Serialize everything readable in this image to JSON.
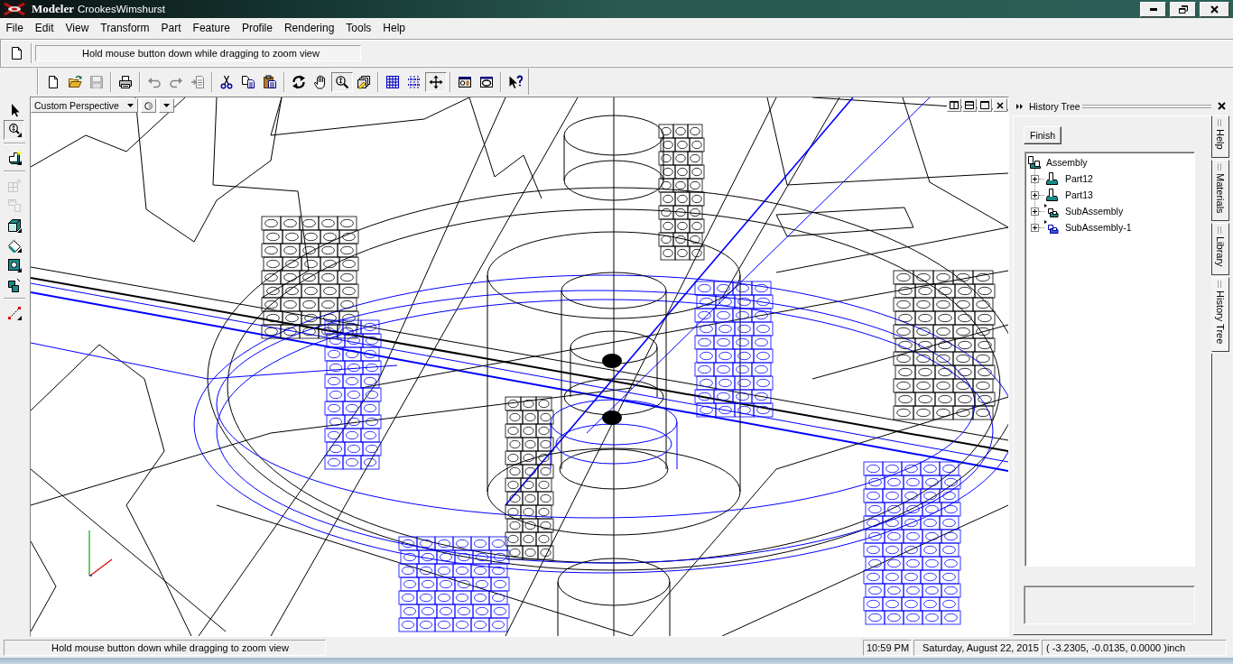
{
  "window": {
    "app_name": "Modeler",
    "document": "CrookesWimshurst"
  },
  "menu": [
    "File",
    "Edit",
    "View",
    "Transform",
    "Part",
    "Feature",
    "Profile",
    "Rendering",
    "Tools",
    "Help"
  ],
  "hint_toolbar": {
    "message": "Hold mouse button down while dragging to zoom view"
  },
  "main_toolbar": {
    "groups": [
      [
        {
          "disabled": false,
          "pressed": false
        },
        {
          "disabled": false,
          "pressed": false
        },
        {
          "disabled": true,
          "pressed": false
        }
      ],
      [
        {
          "disabled": false,
          "pressed": false
        }
      ],
      [
        {
          "disabled": true,
          "pressed": false
        },
        {
          "disabled": true,
          "pressed": false
        },
        {
          "disabled": true,
          "pressed": false
        }
      ],
      [
        {
          "disabled": false,
          "pressed": false
        },
        {
          "disabled": false,
          "pressed": false
        },
        {
          "disabled": false,
          "pressed": false
        }
      ],
      [
        {
          "disabled": false,
          "pressed": false
        },
        {
          "disabled": false,
          "pressed": false
        },
        {
          "disabled": false,
          "pressed": true
        },
        {
          "disabled": false,
          "pressed": false
        }
      ],
      [
        {
          "disabled": false,
          "pressed": false
        },
        {
          "disabled": false,
          "pressed": false
        },
        {
          "disabled": false,
          "pressed": true
        }
      ],
      [
        {
          "disabled": false,
          "pressed": false
        },
        {
          "disabled": false,
          "pressed": false
        }
      ],
      [
        {
          "disabled": false,
          "pressed": false
        }
      ]
    ]
  },
  "side_toolbar": {
    "groups": [
      [
        {
          "disabled": false,
          "pressed": false
        },
        {
          "disabled": false,
          "pressed": true
        }
      ],
      [
        {
          "disabled": false,
          "pressed": false
        }
      ],
      [
        {
          "disabled": true,
          "pressed": false
        },
        {
          "disabled": true,
          "pressed": false
        },
        {
          "disabled": false,
          "pressed": false
        },
        {
          "disabled": false,
          "pressed": false
        },
        {
          "disabled": false,
          "pressed": false
        },
        {
          "disabled": false,
          "pressed": false
        }
      ],
      [
        {
          "disabled": false,
          "pressed": false
        }
      ]
    ]
  },
  "viewport": {
    "view_mode": "Custom Perspective"
  },
  "history_panel": {
    "title": "History Tree",
    "button": "Finish",
    "tree": {
      "label": "Assembly",
      "kind": "assembly",
      "children": [
        {
          "label": "Part12",
          "kind": "part",
          "expanded": false,
          "current": false
        },
        {
          "label": "Part13",
          "kind": "part",
          "expanded": false,
          "current": false
        },
        {
          "label": "SubAssembly",
          "kind": "subassembly",
          "expanded": false,
          "current": false
        },
        {
          "label": "SubAssembly-1",
          "kind": "subassembly",
          "expanded": false,
          "current": true
        }
      ]
    },
    "tabs": [
      {
        "label": "Help",
        "selected": false
      },
      {
        "label": "Materials",
        "selected": false
      },
      {
        "label": "Library",
        "selected": false
      },
      {
        "label": "History Tree",
        "selected": true
      }
    ]
  },
  "status_bar": {
    "message": "Hold mouse button down while dragging to zoom view",
    "time": "10:59 PM",
    "date": "Saturday, August 22, 2015",
    "coordinates": "( -3.2305, -0.0135, 0.0000 )inch"
  }
}
